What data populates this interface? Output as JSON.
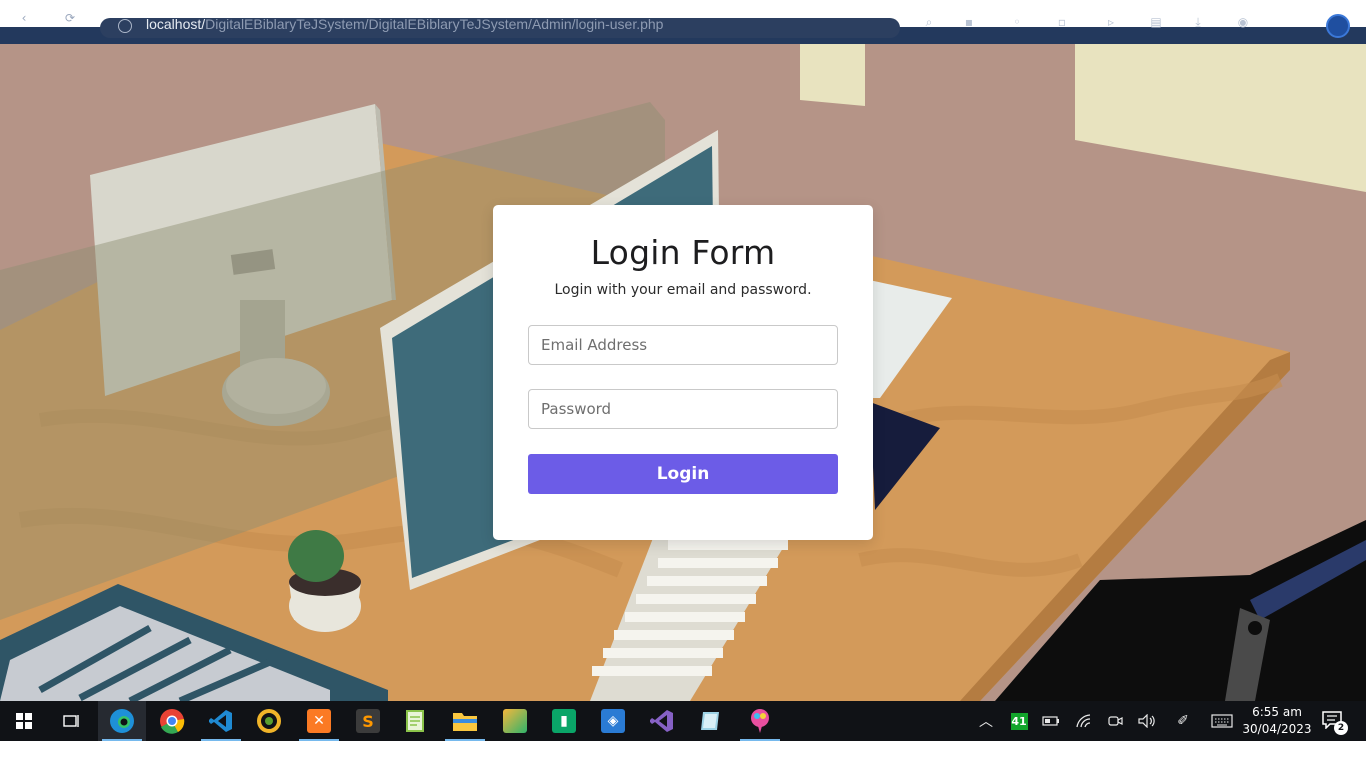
{
  "browser": {
    "url_host": "localhost/",
    "url_path": "DigitalEBiblaryTeJSystem/DigitalEBiblaryTeJSystem/Admin/login-user.php",
    "back_icon": "arrow-left-icon",
    "refresh_icon": "refresh-icon"
  },
  "login": {
    "title": "Login Form",
    "subtitle": "Login with your email and password.",
    "email_placeholder": "Email Address",
    "password_placeholder": "Password",
    "button_label": "Login",
    "accent_color": "#6c5ce7"
  },
  "taskbar": {
    "apps": [
      {
        "name": "start",
        "icon": "windows-start-icon",
        "color": "#ffffff"
      },
      {
        "name": "task-view",
        "icon": "task-view-icon",
        "color": "#ffffff"
      },
      {
        "name": "edge",
        "icon": "edge-icon",
        "color": "#1e90d8",
        "active": true
      },
      {
        "name": "chrome",
        "icon": "chrome-icon",
        "color": "#e94335"
      },
      {
        "name": "vscode",
        "icon": "vscode-icon",
        "color": "#1f8ad2",
        "running": true
      },
      {
        "name": "chameleon",
        "icon": "chameleon-icon",
        "color": "#f0b429"
      },
      {
        "name": "xampp",
        "icon": "xampp-icon",
        "color": "#fb7a24",
        "running": true
      },
      {
        "name": "sublime",
        "icon": "sublime-icon",
        "color": "#ff9800"
      },
      {
        "name": "notepad",
        "icon": "notepad-icon",
        "color": "#8bc34a"
      },
      {
        "name": "explorer",
        "icon": "file-explorer-icon",
        "color": "#f9c740",
        "running": true
      },
      {
        "name": "snip",
        "icon": "snip-icon",
        "color": "#2fb36b"
      },
      {
        "name": "app-green",
        "icon": "green-app-icon",
        "color": "#0aa568"
      },
      {
        "name": "virtualbox",
        "icon": "box-icon",
        "color": "#2a7bd4"
      },
      {
        "name": "visual-studio",
        "icon": "visual-studio-icon",
        "color": "#8661c5"
      },
      {
        "name": "notes",
        "icon": "note-icon",
        "color": "#9dd3e6"
      },
      {
        "name": "paint",
        "icon": "paint-icon",
        "color": "#e94fa0",
        "running": true
      }
    ],
    "tray": {
      "battery_badge": "41",
      "time": "6:55 am",
      "date": "30/04/2023",
      "notification_count": "2"
    }
  }
}
